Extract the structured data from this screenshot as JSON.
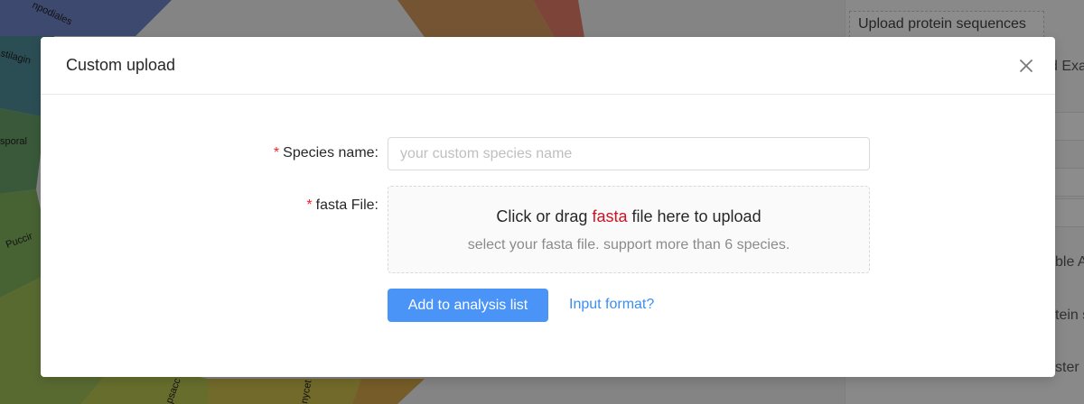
{
  "background": {
    "chart_labels": [
      "npodiales",
      "stilagin",
      "sporal",
      "Puccir",
      "psacc",
      "nycet"
    ],
    "right_panel": {
      "upload_button_label": "Upload protein sequences",
      "fragments": [
        "d Exa",
        "ble A",
        "tein s",
        "ster"
      ]
    }
  },
  "modal": {
    "title": "Custom upload",
    "close_icon": "close-icon",
    "species_field": {
      "required_mark": "*",
      "label": "Species name:",
      "placeholder": "your custom species name",
      "value": ""
    },
    "fasta_field": {
      "required_mark": "*",
      "label": "fasta File:",
      "drag_text_before": "Click or drag ",
      "drag_text_highlight": "fasta",
      "drag_text_after": " file here to upload",
      "hint": "select your fasta file. support more than 6 species."
    },
    "add_button_label": "Add to analysis list",
    "input_format_link": "Input format?"
  },
  "colors": {
    "primary": "#4a93f7",
    "link": "#3c8ef1",
    "required": "#f5222d",
    "highlight": "#cf1322"
  }
}
